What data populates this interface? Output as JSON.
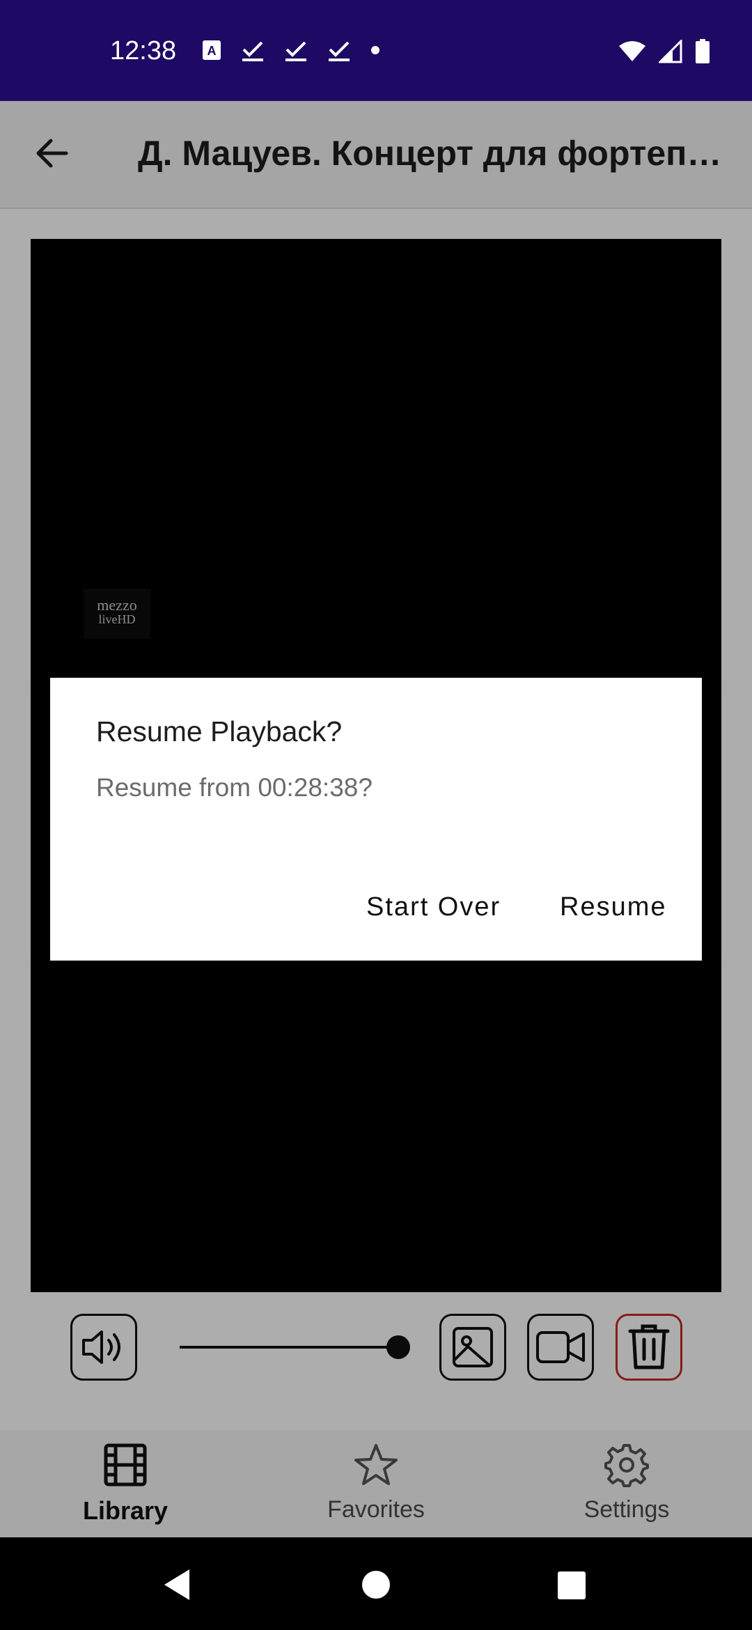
{
  "status_bar": {
    "time": "12:38",
    "left_icons": [
      "a-icon",
      "download-done-icon",
      "download-done-icon",
      "download-done-icon",
      "dot-icon"
    ],
    "right_icons": [
      "wifi-icon",
      "signal-icon",
      "battery-icon"
    ]
  },
  "app_bar": {
    "title": "Д. Мацуев. Концерт для фортепиано с оркестром",
    "back_icon": "arrow-back-icon"
  },
  "video": {
    "watermark_line1": "mezzo",
    "watermark_line2": "liveHD"
  },
  "controls": {
    "volume_icon": "volume-icon",
    "volume_level": 1.0,
    "image_icon": "image-icon",
    "video_icon": "video-camera-icon",
    "delete_icon": "trash-icon",
    "delete_color": "#c62828"
  },
  "bottom_nav": {
    "items": [
      {
        "label": "Library",
        "icon": "film-icon",
        "active": true
      },
      {
        "label": "Favorites",
        "icon": "star-icon",
        "active": false
      },
      {
        "label": "Settings",
        "icon": "gear-icon",
        "active": false
      }
    ]
  },
  "dialog": {
    "title": "Resume Playback?",
    "message": "Resume from 00:28:38?",
    "start_over_label": "Start Over",
    "resume_label": "Resume"
  },
  "colors": {
    "status_bar": "#1e0a64",
    "accent": "#1e0a64"
  }
}
